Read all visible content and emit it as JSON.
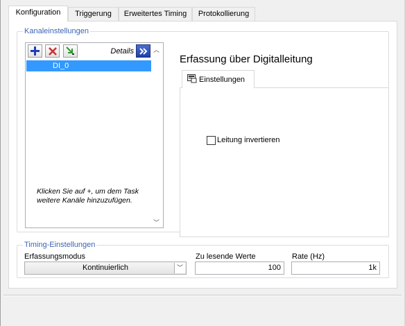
{
  "tabs": [
    {
      "label": "Konfiguration",
      "active": true
    },
    {
      "label": "Triggerung",
      "active": false
    },
    {
      "label": "Erweitertes Timing",
      "active": false
    },
    {
      "label": "Protokollierung",
      "active": false
    }
  ],
  "channel_settings": {
    "legend": "Kanaleinstellungen",
    "details_label": "Details",
    "channels": [
      "DI_0"
    ],
    "help_text": "Klicken Sie auf +, um dem Task weitere Kanäle hinzuzufügen.",
    "toolbar_icons": [
      "add-icon",
      "delete-icon",
      "move-icon",
      "expand-details-icon"
    ]
  },
  "acquisition": {
    "title": "Erfassung über Digitalleitung",
    "inner_tab": "Einstellungen",
    "invert_label": "Leitung invertieren",
    "invert_checked": false
  },
  "timing": {
    "legend": "Timing-Einstellungen",
    "mode_label": "Erfassungsmodus",
    "mode_value": "Kontinuierlich",
    "samples_label": "Zu lesende Werte",
    "samples_value": "100",
    "rate_label": "Rate (Hz)",
    "rate_value": "1k"
  },
  "colors": {
    "legend": "#3c64b4",
    "selection": "#3399ff",
    "add_icon": "#1e3fb4",
    "delete_icon": "#d03030",
    "move_icon": "#2a9a2a"
  }
}
